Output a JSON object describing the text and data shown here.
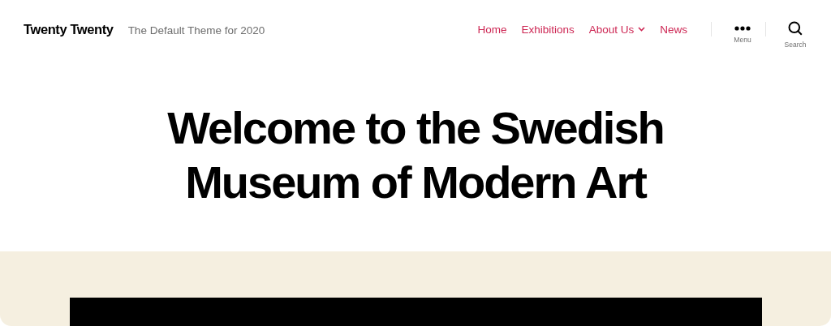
{
  "site": {
    "title": "Twenty Twenty",
    "tagline": "The Default Theme for 2020"
  },
  "nav": [
    {
      "label": "Home",
      "kind": "link"
    },
    {
      "label": "Exhibitions",
      "kind": "link"
    },
    {
      "label": "About Us",
      "kind": "dropdown"
    },
    {
      "label": "News",
      "kind": "link"
    }
  ],
  "toggles": [
    {
      "label": "Menu",
      "kind": "menu"
    },
    {
      "label": "Search",
      "kind": "search"
    }
  ],
  "hero": {
    "title": "Welcome to the Swedish Museum of Modern Art"
  },
  "featured": {
    "kind": "block"
  }
}
